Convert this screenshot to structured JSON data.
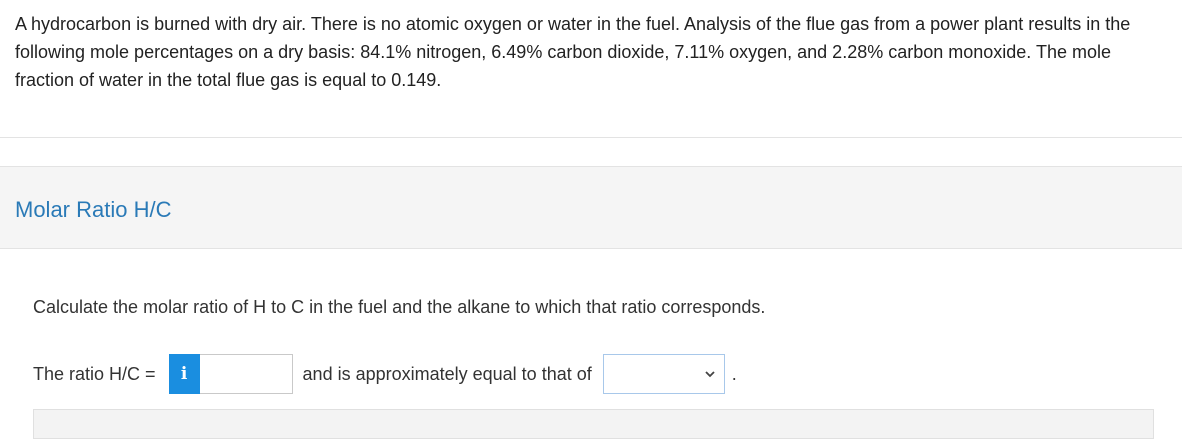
{
  "problem": {
    "text": "A hydrocarbon is burned with dry air. There is no atomic oxygen or water in the fuel. Analysis of the flue gas from a power plant results in the following mole percentages on a dry basis: 84.1% nitrogen, 6.49% carbon dioxide, 7.11% oxygen, and 2.28% carbon monoxide. The mole fraction of water in the total flue gas is equal to 0.149."
  },
  "section": {
    "title": "Molar Ratio H/C"
  },
  "question": {
    "instruction": "Calculate the molar ratio of H to C in the fuel and the alkane to which that ratio corresponds.",
    "ratio_label": "The ratio H/C =",
    "info_icon": "i",
    "ratio_value": "",
    "approx_label": "and is approximately equal to that of",
    "alkane_selected": "",
    "period": "."
  },
  "colors": {
    "accent": "#2a7ab7",
    "info_button": "#1a8ee0",
    "header_bg": "#f5f5f5"
  }
}
